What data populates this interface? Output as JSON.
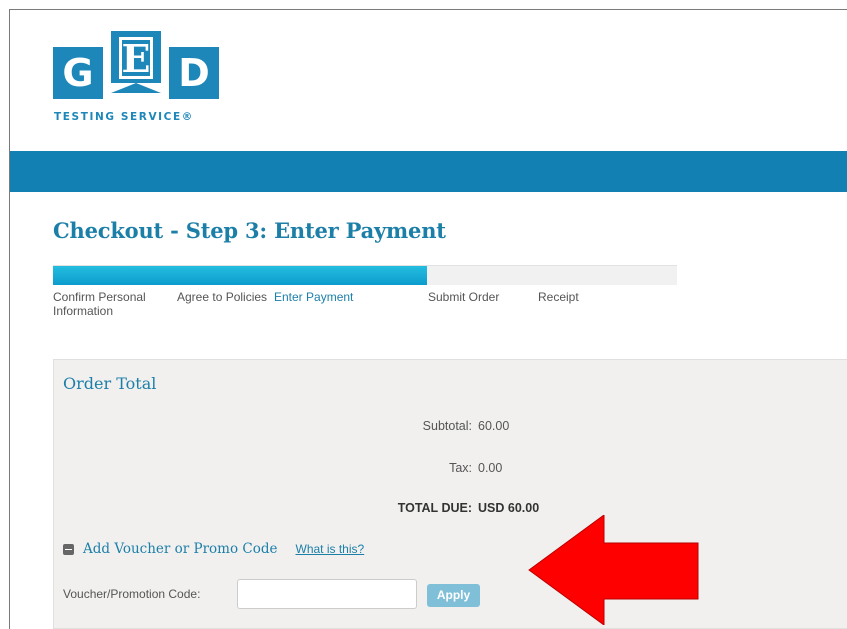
{
  "logo": {
    "letters": [
      "G",
      "E",
      "D"
    ],
    "tagline": "TESTING SERVICE®",
    "brand_color": "#1e87b9"
  },
  "header_band": {
    "color": "#1280b3"
  },
  "page_title": "Checkout - Step 3: Enter Payment",
  "progress": {
    "fraction_complete": 0.6,
    "fill_color": "#13ace0",
    "steps": [
      {
        "label": "Confirm Personal Information",
        "active": false
      },
      {
        "label": "Agree to Policies",
        "active": false
      },
      {
        "label": "Enter Payment",
        "active": true
      },
      {
        "label": "Submit Order",
        "active": false
      },
      {
        "label": "Receipt",
        "active": false
      }
    ]
  },
  "order": {
    "title": "Order Total",
    "subtotal_label": "Subtotal:",
    "subtotal_value": "60.00",
    "tax_label": "Tax:",
    "tax_value": "0.00",
    "total_label": "TOTAL DUE:",
    "total_value": "USD 60.00"
  },
  "voucher": {
    "toggle_label": "Add Voucher or Promo Code",
    "help_link": "What is this?",
    "field_label": "Voucher/Promotion Code:",
    "field_value": "",
    "field_placeholder": "",
    "apply_label": "Apply"
  },
  "annotation": {
    "icon": "red-arrow-icon",
    "color": "#ff0000"
  }
}
